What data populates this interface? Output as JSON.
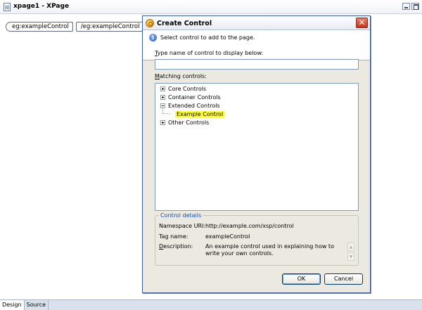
{
  "window": {
    "title": "xpage1 - XPage",
    "tags": {
      "open": "eg:exampleControl",
      "close": "/eg:exampleControl"
    },
    "bottom_tabs": [
      "Design",
      "Source"
    ]
  },
  "dialog": {
    "title": "Create Control",
    "message": "Select control to add to the page.",
    "name_label_first": "T",
    "name_label_rest": "ype name of control to display below:",
    "name_value": "",
    "matching_label_first": "M",
    "matching_label_rest": "atching controls:",
    "tree": [
      {
        "label": "Core Controls",
        "expanded": false
      },
      {
        "label": "Container Controls",
        "expanded": false
      },
      {
        "label": "Extended Controls",
        "expanded": true
      },
      {
        "label": "Example Control",
        "selected": true
      },
      {
        "label": "Other Controls",
        "expanded": false
      }
    ],
    "details": {
      "title": "Control details",
      "namespace_label": "Namespace URI:",
      "namespace_value": "http://example.com/xsp/control",
      "tag_label": "Tag name:",
      "tag_value": "exampleControl",
      "desc_label_first": "D",
      "desc_label_rest": "escription:",
      "desc_value": "An example control used in explaining how to write your own controls."
    },
    "ok_label": "OK",
    "cancel_label": "Cancel"
  },
  "icons": {
    "dialog": "control-wizard-icon",
    "info": "info-icon",
    "close": "close-icon"
  }
}
